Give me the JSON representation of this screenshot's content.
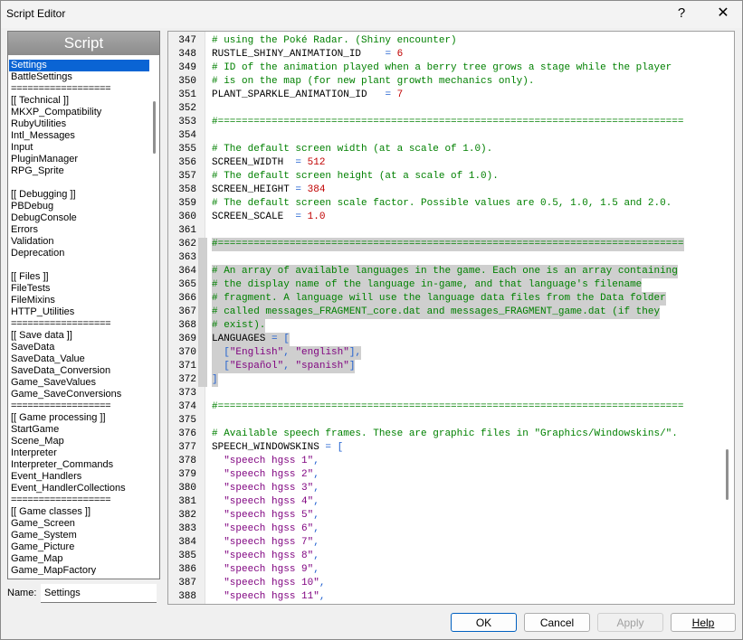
{
  "window": {
    "title": "Script Editor",
    "help_button": "?",
    "close_button": "✕"
  },
  "left": {
    "header": "Script",
    "scripts": [
      {
        "label": "Settings",
        "selected": true
      },
      {
        "label": "BattleSettings"
      },
      {
        "label": "=================="
      },
      {
        "label": "[[ Technical ]]"
      },
      {
        "label": "MKXP_Compatibility"
      },
      {
        "label": "RubyUtilities"
      },
      {
        "label": "Intl_Messages"
      },
      {
        "label": "Input"
      },
      {
        "label": "PluginManager"
      },
      {
        "label": "RPG_Sprite"
      },
      {
        "label": ""
      },
      {
        "label": "[[ Debugging ]]"
      },
      {
        "label": "PBDebug"
      },
      {
        "label": "DebugConsole"
      },
      {
        "label": "Errors"
      },
      {
        "label": "Validation"
      },
      {
        "label": "Deprecation"
      },
      {
        "label": ""
      },
      {
        "label": "[[ Files ]]"
      },
      {
        "label": "FileTests"
      },
      {
        "label": "FileMixins"
      },
      {
        "label": "HTTP_Utilities"
      },
      {
        "label": "=================="
      },
      {
        "label": "[[ Save data ]]"
      },
      {
        "label": "SaveData"
      },
      {
        "label": "SaveData_Value"
      },
      {
        "label": "SaveData_Conversion"
      },
      {
        "label": "Game_SaveValues"
      },
      {
        "label": "Game_SaveConversions"
      },
      {
        "label": "=================="
      },
      {
        "label": "[[ Game processing ]]"
      },
      {
        "label": "StartGame"
      },
      {
        "label": "Scene_Map"
      },
      {
        "label": "Interpreter"
      },
      {
        "label": "Interpreter_Commands"
      },
      {
        "label": "Event_Handlers"
      },
      {
        "label": "Event_HandlerCollections"
      },
      {
        "label": "=================="
      },
      {
        "label": "[[ Game classes ]]"
      },
      {
        "label": "Game_Screen"
      },
      {
        "label": "Game_System"
      },
      {
        "label": "Game_Picture"
      },
      {
        "label": "Game_Map"
      },
      {
        "label": "Game_MapFactory"
      }
    ]
  },
  "name_field": {
    "label": "Name:",
    "value": "Settings"
  },
  "code": {
    "colors": {
      "comment": "#008000",
      "string": "#7f007f",
      "number": "#c00000",
      "operator": "#2060d0",
      "highlight": "#cfcfcf"
    },
    "lines": [
      {
        "n": "347",
        "hl": false,
        "parts": [
          [
            "c",
            "# using the Poké Radar. (Shiny encounter)"
          ]
        ]
      },
      {
        "n": "348",
        "hl": false,
        "parts": [
          [
            "i",
            "RUSTLE_SHINY_ANIMATION_ID    "
          ],
          [
            "o",
            "= "
          ],
          [
            "num",
            "6"
          ]
        ]
      },
      {
        "n": "349",
        "hl": false,
        "parts": [
          [
            "c",
            "# ID of the animation played when a berry tree grows a stage while the player"
          ]
        ]
      },
      {
        "n": "350",
        "hl": false,
        "parts": [
          [
            "c",
            "# is on the map (for new plant growth mechanics only)."
          ]
        ]
      },
      {
        "n": "351",
        "hl": false,
        "parts": [
          [
            "i",
            "PLANT_SPARKLE_ANIMATION_ID   "
          ],
          [
            "o",
            "= "
          ],
          [
            "num",
            "7"
          ]
        ]
      },
      {
        "n": "352",
        "hl": false,
        "parts": []
      },
      {
        "n": "353",
        "hl": false,
        "parts": [
          [
            "c",
            "#=============================================================================="
          ]
        ]
      },
      {
        "n": "354",
        "hl": false,
        "parts": []
      },
      {
        "n": "355",
        "hl": false,
        "parts": [
          [
            "c",
            "# The default screen width (at a scale of 1.0)."
          ]
        ]
      },
      {
        "n": "356",
        "hl": false,
        "parts": [
          [
            "i",
            "SCREEN_WIDTH  "
          ],
          [
            "o",
            "= "
          ],
          [
            "num",
            "512"
          ]
        ]
      },
      {
        "n": "357",
        "hl": false,
        "parts": [
          [
            "c",
            "# The default screen height (at a scale of 1.0)."
          ]
        ]
      },
      {
        "n": "358",
        "hl": false,
        "parts": [
          [
            "i",
            "SCREEN_HEIGHT "
          ],
          [
            "o",
            "= "
          ],
          [
            "num",
            "384"
          ]
        ]
      },
      {
        "n": "359",
        "hl": false,
        "parts": [
          [
            "c",
            "# The default screen scale factor. Possible values are 0.5, 1.0, 1.5 and 2.0."
          ]
        ]
      },
      {
        "n": "360",
        "hl": false,
        "parts": [
          [
            "i",
            "SCREEN_SCALE  "
          ],
          [
            "o",
            "= "
          ],
          [
            "num",
            "1.0"
          ]
        ]
      },
      {
        "n": "361",
        "hl": false,
        "parts": []
      },
      {
        "n": "362",
        "hl": true,
        "parts": [
          [
            "c",
            "#=============================================================================="
          ]
        ]
      },
      {
        "n": "363",
        "hl": true,
        "parts": []
      },
      {
        "n": "364",
        "hl": true,
        "parts": [
          [
            "c",
            "# An array of available languages in the game. Each one is an array containing"
          ]
        ]
      },
      {
        "n": "365",
        "hl": true,
        "parts": [
          [
            "c",
            "# the display name of the language in-game, and that language's filename"
          ]
        ]
      },
      {
        "n": "366",
        "hl": true,
        "parts": [
          [
            "c",
            "# fragment. A language will use the language data files from the Data folder"
          ]
        ]
      },
      {
        "n": "367",
        "hl": true,
        "parts": [
          [
            "c",
            "# called messages_FRAGMENT_core.dat and messages_FRAGMENT_game.dat (if they"
          ]
        ]
      },
      {
        "n": "368",
        "hl": true,
        "parts": [
          [
            "c",
            "# exist)."
          ]
        ]
      },
      {
        "n": "369",
        "hl": true,
        "parts": [
          [
            "i",
            "LANGUAGES "
          ],
          [
            "o",
            "= ["
          ]
        ]
      },
      {
        "n": "370",
        "hl": true,
        "parts": [
          [
            "o",
            "  ["
          ],
          [
            "s",
            "\"English\""
          ],
          [
            "o",
            ", "
          ],
          [
            "s",
            "\"english\""
          ],
          [
            "o",
            "],"
          ]
        ]
      },
      {
        "n": "371",
        "hl": true,
        "parts": [
          [
            "o",
            "  ["
          ],
          [
            "s",
            "\"Español\""
          ],
          [
            "o",
            ", "
          ],
          [
            "s",
            "\"spanish\""
          ],
          [
            "o",
            "]"
          ]
        ]
      },
      {
        "n": "372",
        "hl": true,
        "parts": [
          [
            "o",
            "]"
          ]
        ]
      },
      {
        "n": "373",
        "hl": false,
        "parts": []
      },
      {
        "n": "374",
        "hl": false,
        "parts": [
          [
            "c",
            "#=============================================================================="
          ]
        ]
      },
      {
        "n": "375",
        "hl": false,
        "parts": []
      },
      {
        "n": "376",
        "hl": false,
        "parts": [
          [
            "c",
            "# Available speech frames. These are graphic files in \"Graphics/Windowskins/\"."
          ]
        ]
      },
      {
        "n": "377",
        "hl": false,
        "parts": [
          [
            "i",
            "SPEECH_WINDOWSKINS "
          ],
          [
            "o",
            "= ["
          ]
        ]
      },
      {
        "n": "378",
        "hl": false,
        "parts": [
          [
            "i",
            "  "
          ],
          [
            "s",
            "\"speech hgss 1\""
          ],
          [
            "o",
            ","
          ]
        ]
      },
      {
        "n": "379",
        "hl": false,
        "parts": [
          [
            "i",
            "  "
          ],
          [
            "s",
            "\"speech hgss 2\""
          ],
          [
            "o",
            ","
          ]
        ]
      },
      {
        "n": "380",
        "hl": false,
        "parts": [
          [
            "i",
            "  "
          ],
          [
            "s",
            "\"speech hgss 3\""
          ],
          [
            "o",
            ","
          ]
        ]
      },
      {
        "n": "381",
        "hl": false,
        "parts": [
          [
            "i",
            "  "
          ],
          [
            "s",
            "\"speech hgss 4\""
          ],
          [
            "o",
            ","
          ]
        ]
      },
      {
        "n": "382",
        "hl": false,
        "parts": [
          [
            "i",
            "  "
          ],
          [
            "s",
            "\"speech hgss 5\""
          ],
          [
            "o",
            ","
          ]
        ]
      },
      {
        "n": "383",
        "hl": false,
        "parts": [
          [
            "i",
            "  "
          ],
          [
            "s",
            "\"speech hgss 6\""
          ],
          [
            "o",
            ","
          ]
        ]
      },
      {
        "n": "384",
        "hl": false,
        "parts": [
          [
            "i",
            "  "
          ],
          [
            "s",
            "\"speech hgss 7\""
          ],
          [
            "o",
            ","
          ]
        ]
      },
      {
        "n": "385",
        "hl": false,
        "parts": [
          [
            "i",
            "  "
          ],
          [
            "s",
            "\"speech hgss 8\""
          ],
          [
            "o",
            ","
          ]
        ]
      },
      {
        "n": "386",
        "hl": false,
        "parts": [
          [
            "i",
            "  "
          ],
          [
            "s",
            "\"speech hgss 9\""
          ],
          [
            "o",
            ","
          ]
        ]
      },
      {
        "n": "387",
        "hl": false,
        "parts": [
          [
            "i",
            "  "
          ],
          [
            "s",
            "\"speech hgss 10\""
          ],
          [
            "o",
            ","
          ]
        ]
      },
      {
        "n": "388",
        "hl": false,
        "parts": [
          [
            "i",
            "  "
          ],
          [
            "s",
            "\"speech hgss 11\""
          ],
          [
            "o",
            ","
          ]
        ]
      }
    ]
  },
  "buttons": {
    "ok": "OK",
    "cancel": "Cancel",
    "apply": "Apply",
    "help": "Help"
  }
}
